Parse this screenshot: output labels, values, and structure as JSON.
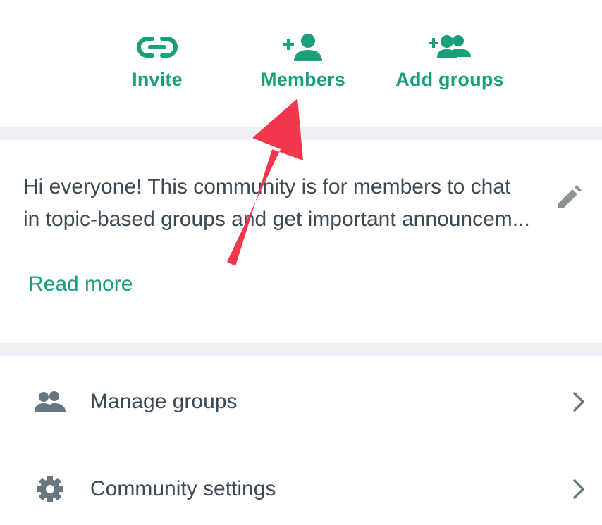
{
  "actions": {
    "invite": {
      "label": "Invite",
      "icon": "link-icon"
    },
    "members": {
      "label": "Members",
      "icon": "add-person-icon"
    },
    "add_groups": {
      "label": "Add groups",
      "icon": "add-group-icon"
    }
  },
  "description": {
    "text": "Hi everyone! This community is for members to chat in topic-based groups and get important announcem...",
    "read_more": "Read more",
    "edit_icon": "pencil-icon"
  },
  "menu": {
    "manage_groups": {
      "label": "Manage groups",
      "icon": "groups-icon"
    },
    "community_settings": {
      "label": "Community settings",
      "icon": "gear-icon"
    }
  },
  "colors": {
    "accent": "#1a9e7c",
    "text": "#3b4a54",
    "divider": "#eef0f5",
    "icon_gray": "#667781",
    "annotation": "#f2364c"
  }
}
